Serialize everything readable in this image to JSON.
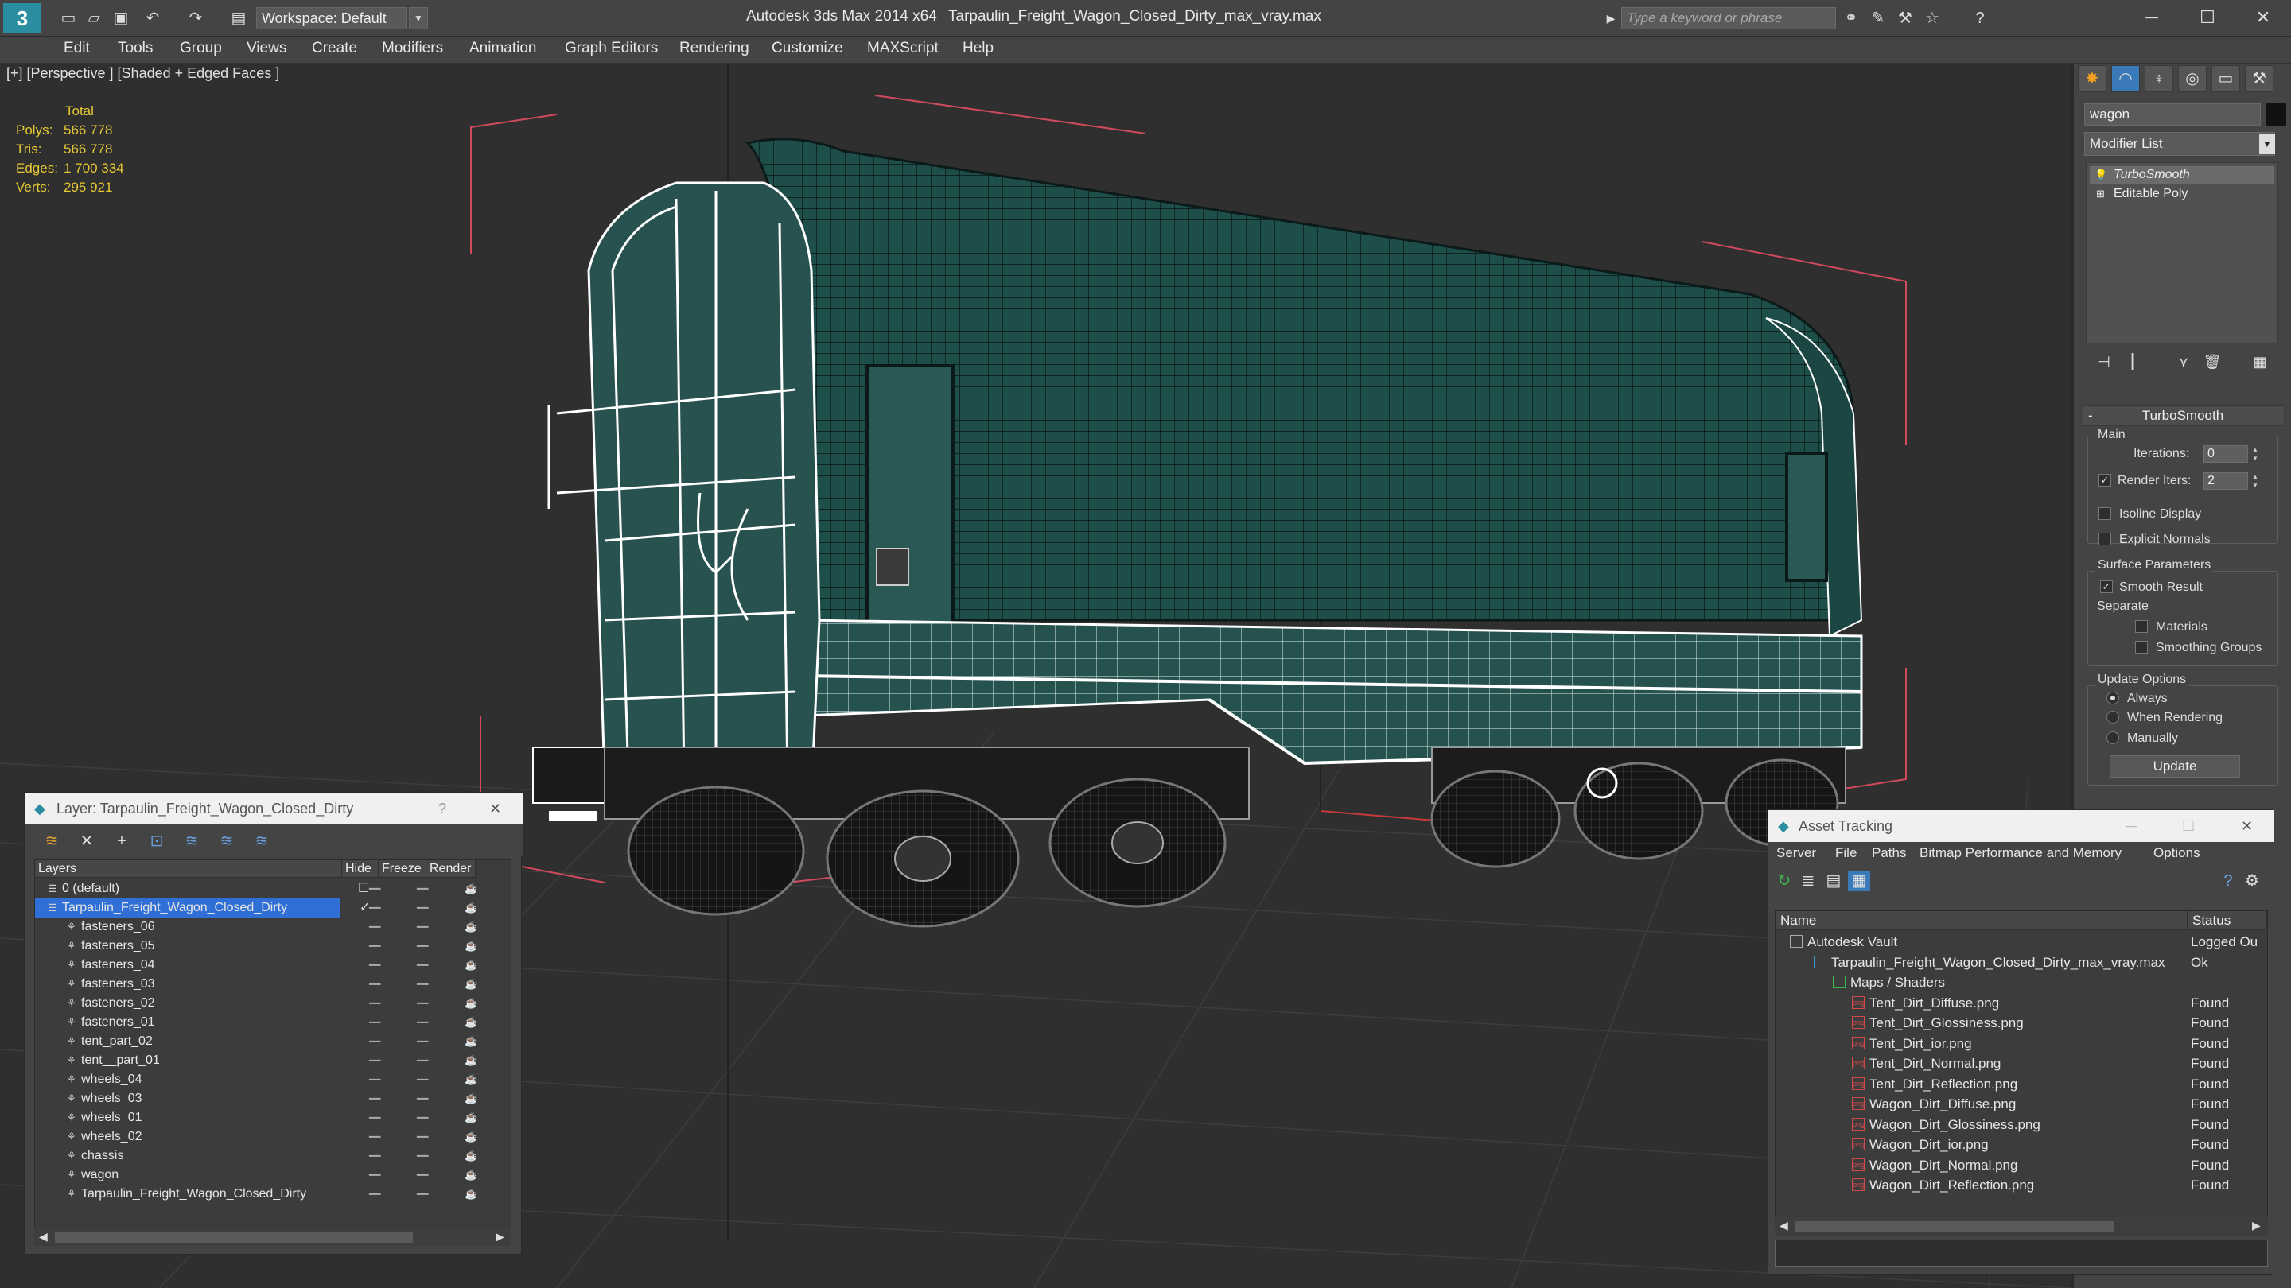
{
  "titlebar": {
    "workspace": "Workspace: Default",
    "app_title": "Autodesk 3ds Max 2014 x64",
    "file_title": "Tarpaulin_Freight_Wagon_Closed_Dirty_max_vray.max",
    "search_placeholder": "Type a keyword or phrase"
  },
  "menubar": [
    "Edit",
    "Tools",
    "Group",
    "Views",
    "Create",
    "Modifiers",
    "Animation",
    "Graph Editors",
    "Rendering",
    "Customize",
    "MAXScript",
    "Help"
  ],
  "viewport": {
    "label": "[+] [Perspective ] [Shaded + Edged Faces ]",
    "stats": {
      "total": "Total",
      "rows": [
        {
          "label": "Polys:",
          "value": "566 778"
        },
        {
          "label": "Tris:",
          "value": "566 778"
        },
        {
          "label": "Edges:",
          "value": "1 700 334"
        },
        {
          "label": "Verts:",
          "value": "295 921"
        }
      ]
    }
  },
  "command_panel": {
    "object_name": "wagon",
    "modifier_list": "Modifier List",
    "stack": [
      "TurboSmooth",
      "Editable Poly"
    ],
    "rollout_title": "TurboSmooth",
    "main_group": "Main",
    "iterations_label": "Iterations:",
    "iterations_value": "0",
    "render_iters_label": "Render Iters:",
    "render_iters_value": "2",
    "isoline_display": "Isoline Display",
    "explicit_normals": "Explicit Normals",
    "surface_params": "Surface Parameters",
    "smooth_result": "Smooth Result",
    "separate": "Separate",
    "materials": "Materials",
    "smoothing_groups": "Smoothing Groups",
    "update_options": "Update Options",
    "always": "Always",
    "when_rendering": "When Rendering",
    "manually": "Manually",
    "update_button": "Update"
  },
  "layer_window": {
    "title": "Layer: Tarpaulin_Freight_Wagon_Closed_Dirty",
    "help": "?",
    "columns": [
      "Layers",
      "Hide",
      "Freeze",
      "Render"
    ],
    "rows": [
      {
        "name": "0 (default)",
        "level": 1
      },
      {
        "name": "Tarpaulin_Freight_Wagon_Closed_Dirty",
        "level": 1
      },
      {
        "name": "fasteners_06",
        "level": 2
      },
      {
        "name": "fasteners_05",
        "level": 2
      },
      {
        "name": "fasteners_04",
        "level": 2
      },
      {
        "name": "fasteners_03",
        "level": 2
      },
      {
        "name": "fasteners_02",
        "level": 2
      },
      {
        "name": "fasteners_01",
        "level": 2
      },
      {
        "name": "tent_part_02",
        "level": 2
      },
      {
        "name": "tent__part_01",
        "level": 2
      },
      {
        "name": "wheels_04",
        "level": 2
      },
      {
        "name": "wheels_03",
        "level": 2
      },
      {
        "name": "wheels_01",
        "level": 2
      },
      {
        "name": "wheels_02",
        "level": 2
      },
      {
        "name": "chassis",
        "level": 2
      },
      {
        "name": "wagon",
        "level": 2
      },
      {
        "name": "Tarpaulin_Freight_Wagon_Closed_Dirty",
        "level": 2
      }
    ]
  },
  "asset_window": {
    "title": "Asset Tracking",
    "menu": [
      "Server",
      "File",
      "Paths",
      "Bitmap Performance and Memory",
      "Options"
    ],
    "columns": [
      "Name",
      "Status"
    ],
    "rows": [
      {
        "name": "Autodesk Vault",
        "status": "Logged Ou",
        "level": 0
      },
      {
        "name": "Tarpaulin_Freight_Wagon_Closed_Dirty_max_vray.max",
        "status": "Ok",
        "level": 1
      },
      {
        "name": "Maps / Shaders",
        "status": "",
        "level": 2
      },
      {
        "name": "Tent_Dirt_Diffuse.png",
        "status": "Found",
        "level": 3
      },
      {
        "name": "Tent_Dirt_Glossiness.png",
        "status": "Found",
        "level": 3
      },
      {
        "name": "Tent_Dirt_ior.png",
        "status": "Found",
        "level": 3
      },
      {
        "name": "Tent_Dirt_Normal.png",
        "status": "Found",
        "level": 3
      },
      {
        "name": "Tent_Dirt_Reflection.png",
        "status": "Found",
        "level": 3
      },
      {
        "name": "Wagon_Dirt_Diffuse.png",
        "status": "Found",
        "level": 3
      },
      {
        "name": "Wagon_Dirt_Glossiness.png",
        "status": "Found",
        "level": 3
      },
      {
        "name": "Wagon_Dirt_ior.png",
        "status": "Found",
        "level": 3
      },
      {
        "name": "Wagon_Dirt_Normal.png",
        "status": "Found",
        "level": 3
      },
      {
        "name": "Wagon_Dirt_Reflection.png",
        "status": "Found",
        "level": 3
      }
    ]
  },
  "colors": {
    "stats_yellow": "#e6c832",
    "selection_blue": "#2f6fd6",
    "wire_white": "#ffffff",
    "tarp_teal": "#1d4a47",
    "bbox_red": "#d04a5c"
  }
}
